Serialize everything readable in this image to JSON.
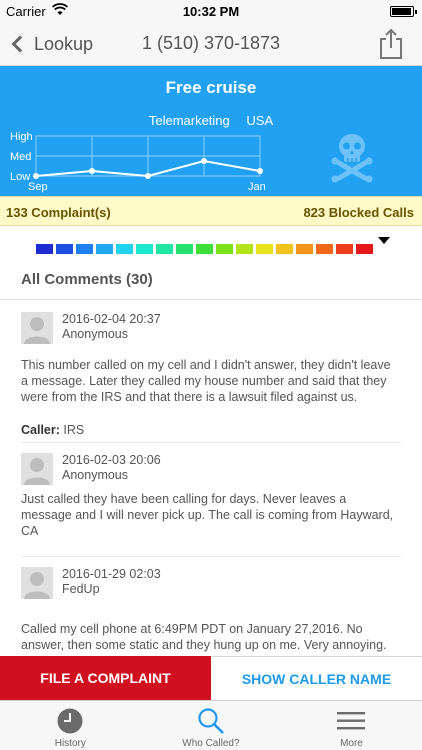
{
  "status": {
    "carrier": "Carrier",
    "time": "10:32 PM"
  },
  "nav": {
    "back_label": "Lookup",
    "title": "1 (510) 370-1873"
  },
  "hero": {
    "title": "Free cruise",
    "category": "Telemarketing",
    "country": "USA",
    "bg_color": "#22a1f2"
  },
  "chart_data": {
    "type": "line",
    "x": [
      "Sep",
      "",
      "",
      "",
      "",
      "Jan"
    ],
    "y_levels": [
      "Low",
      "Med",
      "High"
    ],
    "values": [
      0.0,
      0.25,
      0.0,
      0.75,
      0.25
    ],
    "x_tick_labels": [
      "Sep",
      "Jan"
    ],
    "y_tick_labels": [
      "High",
      "Med",
      "Low"
    ],
    "ylim": [
      0,
      2
    ],
    "grid": true
  },
  "stats": {
    "complaints": "133 Complaint(s)",
    "blocked": "823 Blocked Calls"
  },
  "severity": {
    "colors": [
      "#1d2bd1",
      "#1e4fe3",
      "#1f7ef0",
      "#20a9ef",
      "#1fd3ee",
      "#1de8cf",
      "#20e6a2",
      "#25e16e",
      "#3cde38",
      "#7ce21c",
      "#b5e31a",
      "#e8e21a",
      "#f0c21a",
      "#f3951a",
      "#f2681b",
      "#ec3d1b",
      "#e5191b"
    ],
    "level_index": 16
  },
  "comments_header": "All Comments (30)",
  "comments": [
    {
      "date": "2016-02-04 20:37",
      "user": "Anonymous",
      "text": "This number called on my cell and I didn't answer, they didn't leave a message. Later they called my house number and said that they were from the IRS and that there is a lawsuit filed against us.",
      "caller_label": "Caller:",
      "caller_value": "IRS"
    },
    {
      "date": "2016-02-03 20:06",
      "user": "Anonymous",
      "text": "Just called they have been calling for days.  Never leaves a message and I will never pick up.  The call is coming from Hayward, CA"
    },
    {
      "date": "2016-01-29 02:03",
      "user": "FedUp",
      "text": "Called my cell phone at 6:49PM PDT on January 27,2016. No answer, then some static and they hung up on me. Very annoying."
    }
  ],
  "actions": {
    "complaint": "FILE A COMPLAINT",
    "show_name": "SHOW CALLER NAME"
  },
  "tabs": [
    {
      "label": "History",
      "icon": "clock-icon"
    },
    {
      "label": "Who Called?",
      "icon": "search-icon"
    },
    {
      "label": "More",
      "icon": "menu-icon"
    }
  ]
}
